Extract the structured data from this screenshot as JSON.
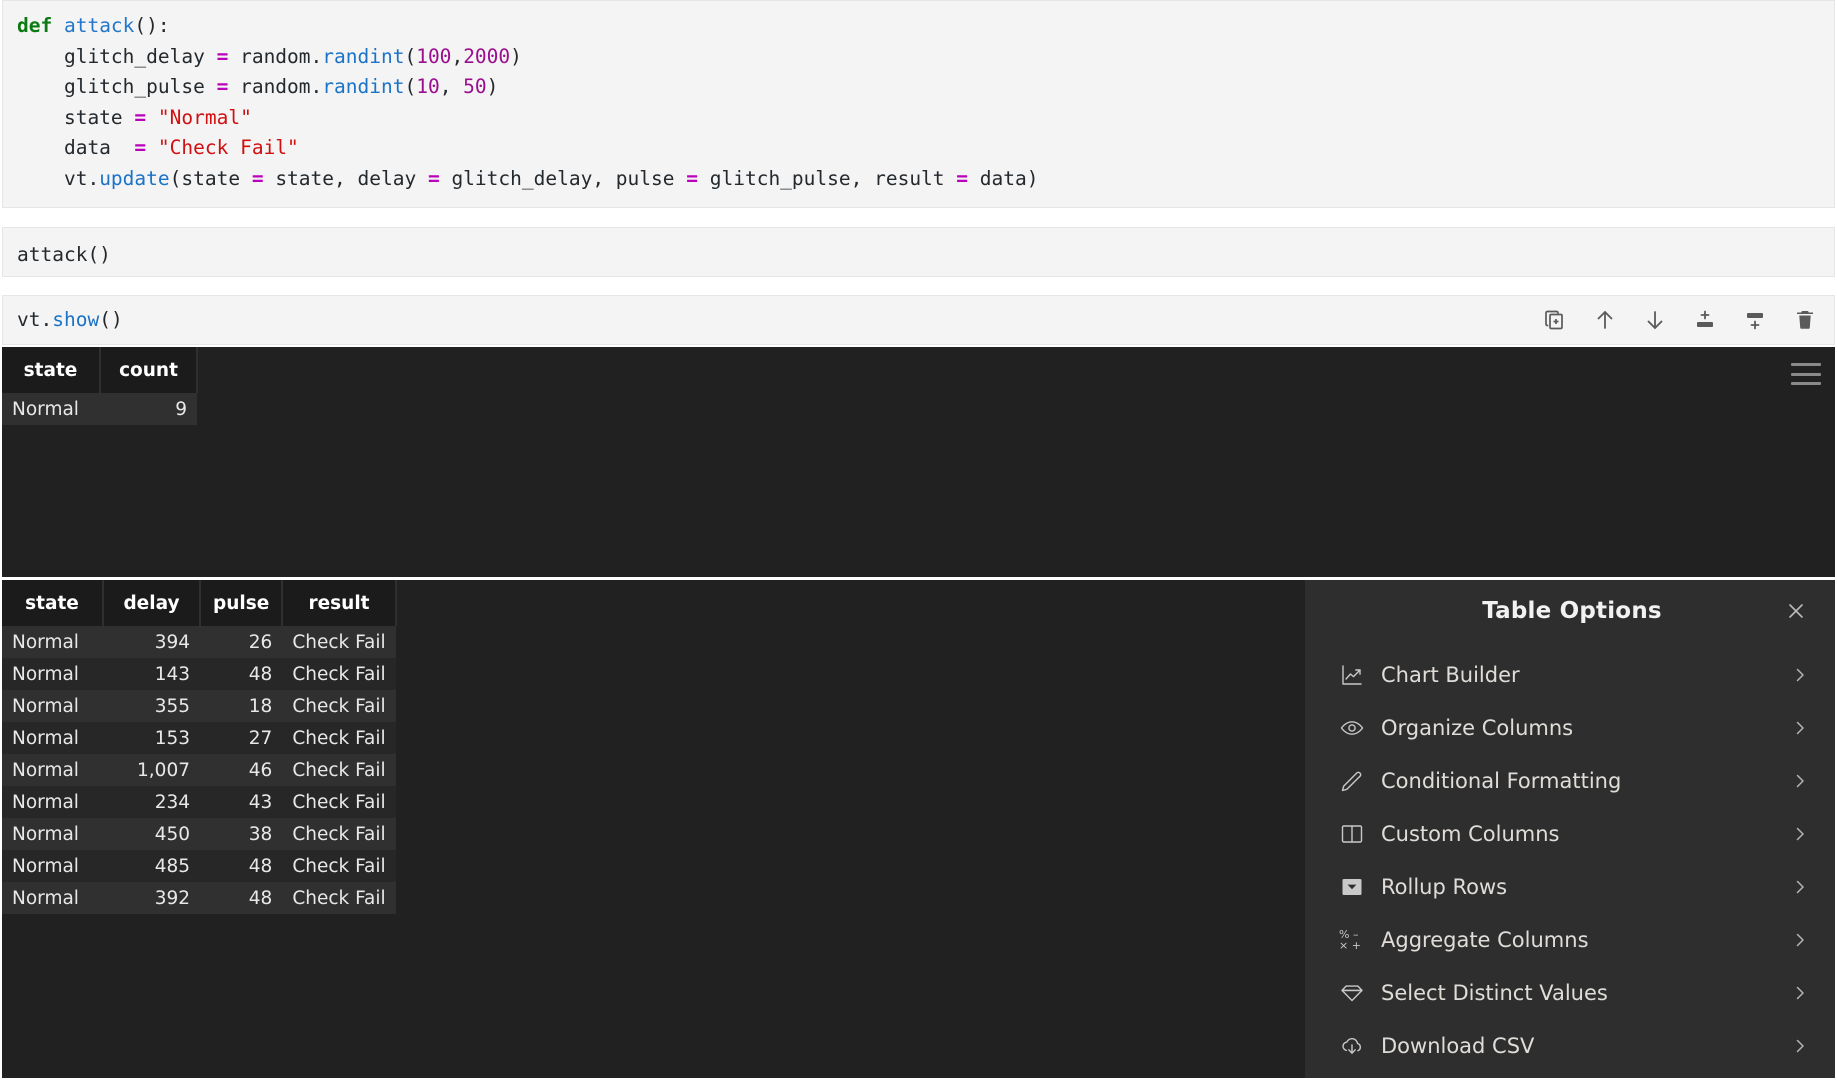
{
  "notebook": {
    "cells": [
      {
        "name": "code-cell-attack-def",
        "lines": [
          [
            {
              "t": "def ",
              "c": "kw"
            },
            {
              "t": "attack",
              "c": "fn"
            },
            {
              "t": "():",
              "c": "pl"
            }
          ],
          [
            {
              "t": "    glitch_delay ",
              "c": "pl"
            },
            {
              "t": "=",
              "c": "op"
            },
            {
              "t": " random.",
              "c": "pl"
            },
            {
              "t": "randint",
              "c": "meth"
            },
            {
              "t": "(",
              "c": "pl"
            },
            {
              "t": "100",
              "c": "num2"
            },
            {
              "t": ",",
              "c": "pl"
            },
            {
              "t": "2000",
              "c": "num2"
            },
            {
              "t": ")",
              "c": "pl"
            }
          ],
          [
            {
              "t": "    glitch_pulse ",
              "c": "pl"
            },
            {
              "t": "=",
              "c": "op"
            },
            {
              "t": " random.",
              "c": "pl"
            },
            {
              "t": "randint",
              "c": "meth"
            },
            {
              "t": "(",
              "c": "pl"
            },
            {
              "t": "10",
              "c": "num2"
            },
            {
              "t": ", ",
              "c": "pl"
            },
            {
              "t": "50",
              "c": "num2"
            },
            {
              "t": ")",
              "c": "pl"
            }
          ],
          [
            {
              "t": "    state ",
              "c": "pl"
            },
            {
              "t": "=",
              "c": "op"
            },
            {
              "t": " ",
              "c": "pl"
            },
            {
              "t": "\"Normal\"",
              "c": "str"
            }
          ],
          [
            {
              "t": "    data  ",
              "c": "pl"
            },
            {
              "t": "=",
              "c": "op"
            },
            {
              "t": " ",
              "c": "pl"
            },
            {
              "t": "\"Check Fail\"",
              "c": "str"
            }
          ],
          [
            {
              "t": "    vt.",
              "c": "pl"
            },
            {
              "t": "update",
              "c": "meth"
            },
            {
              "t": "(state ",
              "c": "pl"
            },
            {
              "t": "=",
              "c": "op"
            },
            {
              "t": " state, delay ",
              "c": "pl"
            },
            {
              "t": "=",
              "c": "op"
            },
            {
              "t": " glitch_delay, pulse ",
              "c": "pl"
            },
            {
              "t": "=",
              "c": "op"
            },
            {
              "t": " glitch_pulse, result ",
              "c": "pl"
            },
            {
              "t": "=",
              "c": "op"
            },
            {
              "t": " data)",
              "c": "pl"
            }
          ]
        ]
      },
      {
        "name": "code-cell-attack-call",
        "lines": [
          [
            {
              "t": "attack()",
              "c": "pl"
            }
          ]
        ]
      },
      {
        "name": "code-cell-vt-show",
        "lines": [
          [
            {
              "t": "vt.",
              "c": "pl"
            },
            {
              "t": "show",
              "c": "meth"
            },
            {
              "t": "()",
              "c": "pl"
            }
          ]
        ]
      }
    ],
    "toolbar": [
      {
        "name": "duplicate-cell-icon",
        "label": "Duplicate Cell"
      },
      {
        "name": "move-cell-up-icon",
        "label": "Move Cell Up"
      },
      {
        "name": "move-cell-down-icon",
        "label": "Move Cell Down"
      },
      {
        "name": "insert-cell-above-icon",
        "label": "Insert Cell Above"
      },
      {
        "name": "insert-cell-below-icon",
        "label": "Insert Cell Below"
      },
      {
        "name": "delete-cell-icon",
        "label": "Delete Cell"
      }
    ]
  },
  "summary_table": {
    "columns": [
      "state",
      "count"
    ],
    "rows": [
      {
        "state": "Normal",
        "count": "9"
      }
    ]
  },
  "detail_table": {
    "columns": [
      "state",
      "delay",
      "pulse",
      "result"
    ],
    "rows": [
      {
        "state": "Normal",
        "delay": "394",
        "pulse": "26",
        "result": "Check Fail"
      },
      {
        "state": "Normal",
        "delay": "143",
        "pulse": "48",
        "result": "Check Fail"
      },
      {
        "state": "Normal",
        "delay": "355",
        "pulse": "18",
        "result": "Check Fail"
      },
      {
        "state": "Normal",
        "delay": "153",
        "pulse": "27",
        "result": "Check Fail"
      },
      {
        "state": "Normal",
        "delay": "1,007",
        "pulse": "46",
        "result": "Check Fail"
      },
      {
        "state": "Normal",
        "delay": "234",
        "pulse": "43",
        "result": "Check Fail"
      },
      {
        "state": "Normal",
        "delay": "450",
        "pulse": "38",
        "result": "Check Fail"
      },
      {
        "state": "Normal",
        "delay": "485",
        "pulse": "48",
        "result": "Check Fail"
      },
      {
        "state": "Normal",
        "delay": "392",
        "pulse": "48",
        "result": "Check Fail"
      }
    ]
  },
  "table_options": {
    "title": "Table Options",
    "close_label": "×",
    "items": [
      {
        "label": "Chart Builder",
        "icon": "chart-line-icon"
      },
      {
        "label": "Organize Columns",
        "icon": "eye-icon"
      },
      {
        "label": "Conditional Formatting",
        "icon": "pencil-icon"
      },
      {
        "label": "Custom Columns",
        "icon": "columns-icon"
      },
      {
        "label": "Rollup Rows",
        "icon": "rollup-caret-icon"
      },
      {
        "label": "Aggregate Columns",
        "icon": "math-operators-icon"
      },
      {
        "label": "Select Distinct Values",
        "icon": "diamond-icon"
      },
      {
        "label": "Download CSV",
        "icon": "cloud-download-icon"
      }
    ]
  },
  "colors": {
    "cell_bg": "#f4f4f4",
    "table_bg": "#212121",
    "header_bg": "#1b1b1b",
    "row_odd": "#303030",
    "row_even": "#272727",
    "numeric_green": "#8fd44a",
    "panel_bg": "#2e2e2e"
  }
}
